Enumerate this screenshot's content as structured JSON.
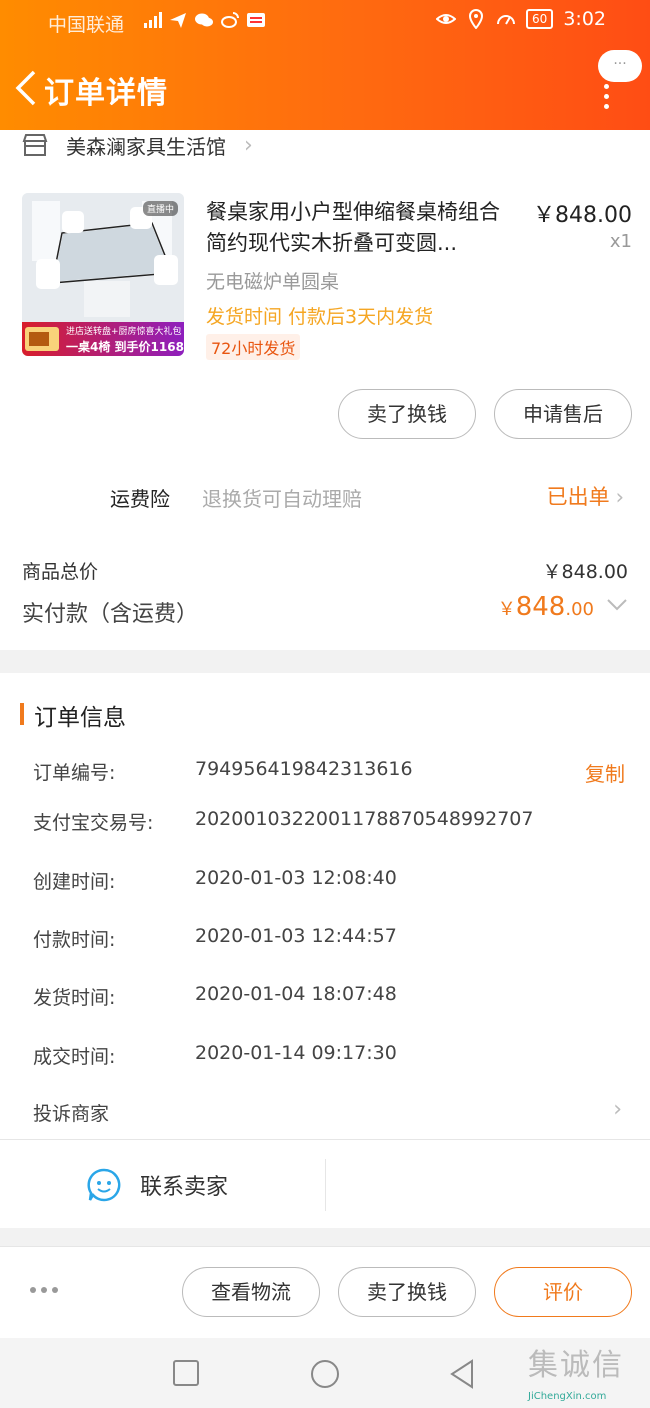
{
  "status_bar": {
    "carrier": "中国联通",
    "network": "46",
    "time": "3:02",
    "battery": "60"
  },
  "nav": {
    "title": "订单详情",
    "more_label": "···"
  },
  "shop": {
    "name": "美森澜家具生活馆"
  },
  "product": {
    "title": "餐桌家用小户型伸缩餐桌椅组合简约现代实木折叠可变圆...",
    "price": "￥848.00",
    "quantity": "x1",
    "spec": "无电磁炉单圆桌",
    "ship_time": "发货时间  付款后3天内发货",
    "ship_tag": "72小时发货",
    "image_live_badge": "直播中",
    "image_promo_line1": "进店送转盘+厨房惊喜大礼包",
    "image_promo_line2": "一桌4椅 到手价1168"
  },
  "product_actions": {
    "sell": "卖了换钱",
    "after_sale": "申请售后"
  },
  "insurance": {
    "label": "运费险",
    "desc": "退换货可自动理赔",
    "status": "已出单"
  },
  "totals": {
    "goods_total_label": "商品总价",
    "goods_total_value": "￥848.00",
    "paid_label": "实付款（含运费）",
    "paid_currency": "￥",
    "paid_int": "848",
    "paid_dec": ".00"
  },
  "order_info": {
    "title": "订单信息",
    "copy_label": "复制",
    "rows": [
      {
        "label": "订单编号:",
        "value": "794956419842313616"
      },
      {
        "label": "支付宝交易号:",
        "value": "2020010322001178870548992707"
      },
      {
        "label": "创建时间:",
        "value": "2020-01-03 12:08:40"
      },
      {
        "label": "付款时间:",
        "value": "2020-01-03 12:44:57"
      },
      {
        "label": "发货时间:",
        "value": "2020-01-04 18:07:48"
      },
      {
        "label": "成交时间:",
        "value": "2020-01-14 09:17:30"
      }
    ],
    "complain": "投诉商家",
    "contact_seller": "联系卖家"
  },
  "bottom_actions": {
    "logistics": "查看物流",
    "sell": "卖了换钱",
    "review": "评价"
  },
  "watermark": {
    "glyphs": "集诚信",
    "url": "JiChengXin.com"
  },
  "colors": {
    "accent": "#f07a1d",
    "header_start": "#ff8c00",
    "header_end": "#ff4d14"
  }
}
